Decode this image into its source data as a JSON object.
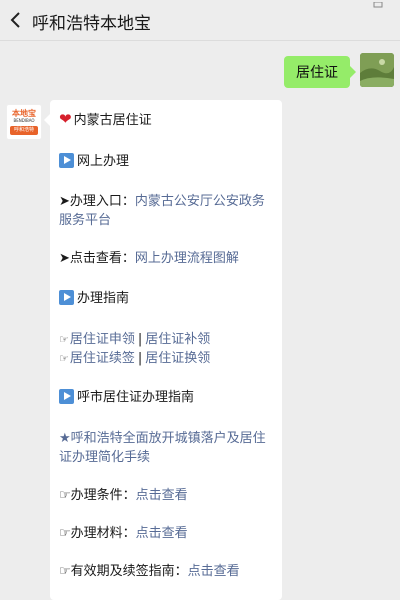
{
  "header": {
    "back_icon": "chevron-left-icon",
    "title": "呼和浩特本地宝",
    "more_icon": "more-icon"
  },
  "my_message": {
    "text": "居住证",
    "bubble_color": "#95ec69"
  },
  "bot": {
    "logo_text": "本地宝",
    "logo_sub": "BENDIBAO",
    "logo_bar": "呼和浩特"
  },
  "card": {
    "title_heart": "❤️",
    "title": "内蒙古居住证",
    "section1": "网上办理",
    "entry_prefix": "➤办理入口：",
    "entry_link_l1": "内蒙古公安厅公安政务",
    "entry_link_l2": "服务平台",
    "view_prefix": "➤点击查看：",
    "view_link": "网上办理流程图解",
    "section2": "办理指南",
    "hand": "☞",
    "guide_apply": "居住证申领",
    "guide_reissue": "居住证补领",
    "guide_renew": "居住证续签",
    "guide_replace": "居住证换领",
    "section3": "呼市居住证办理指南",
    "star_link_l1": "★呼和浩特全面放开城镇落户及居住",
    "star_link_l2": "证办理简化手续",
    "cond_prefix": "☞办理条件：",
    "cond_link": "点击查看",
    "mat_prefix": "☞办理材料：",
    "mat_link": "点击查看",
    "valid_prefix": "☞有效期及续签指南：",
    "valid_link": "点击查看",
    "link_color": "#576b95"
  }
}
